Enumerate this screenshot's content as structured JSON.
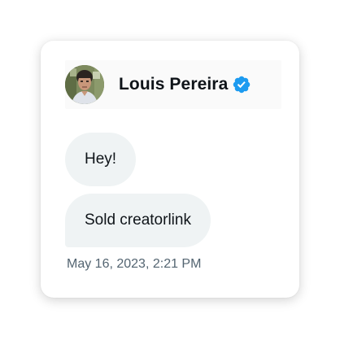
{
  "sender": {
    "name": "Louis Pereira",
    "verified": true,
    "avatar_icon": "profile-photo",
    "verified_icon": "verified-badge-icon",
    "verified_color": "#1d9bf0"
  },
  "messages": [
    {
      "text": "Hey!"
    },
    {
      "text": "Sold creatorlink"
    }
  ],
  "timestamp": "May 16, 2023, 2:21 PM",
  "colors": {
    "bubble_background": "#eff3f4",
    "text": "#0f1419",
    "secondary_text": "#536471"
  }
}
